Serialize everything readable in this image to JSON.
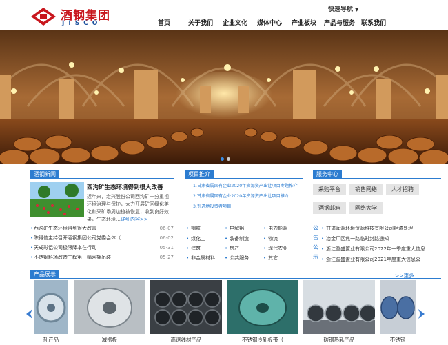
{
  "header": {
    "brand_cn": "酒钢集团",
    "brand_en": "JISCO",
    "quick_nav": "快速导航"
  },
  "nav": {
    "items": [
      "首页",
      "关于我们",
      "企业文化",
      "媒体中心",
      "产业板块",
      "产品与服务",
      "联系我们"
    ]
  },
  "banner": {
    "slides": 2,
    "active_slide": 1
  },
  "news": {
    "title": "酒钢新闻",
    "featured_title": "西沟矿生态环境得到很大改善",
    "featured_summary": "近年来，宏兴股份公司西沟矿十分重视环境治理与保护，大力开展矿区绿化美化和采矿场周边植被恢复，收到良好效果，生态环境…",
    "featured_more": "详细内容>>",
    "items": [
      {
        "title": "西沟矿生态环境得到很大改善",
        "date": "06-07"
      },
      {
        "title": "陈得信主持召开酒钢集团公司党委会体（",
        "date": "06-02"
      },
      {
        "title": "天成彩铝公司极限降本在行动",
        "date": "05-31"
      },
      {
        "title": "不锈钢料场改造工程第一幅网架吊装",
        "date": "05-27"
      }
    ]
  },
  "projects": {
    "title": "项目推介",
    "items": [
      "1.甘肃省属国有企业2020年资源资产出让项目专题推介",
      "2.甘肃省属国有企业2020年资源资产出让项目推介",
      "3.引进地投资者项目"
    ]
  },
  "industries": {
    "items": [
      "钢铁",
      "电解铝",
      "电力能源",
      "煤化工",
      "装备制造",
      "物流",
      "建筑",
      "房产",
      "现代农业",
      "非金属材料",
      "公共服务",
      "其它"
    ]
  },
  "services": {
    "title": "服务中心",
    "buttons": [
      "采购平台",
      "销售网络",
      "人才招聘",
      "酒钢邮箱",
      "网络大学"
    ],
    "notice_label": "公告公示",
    "notices": [
      "甘肃润源环境资源科技有限公司铝渣处理",
      "冶金厂区焦一路临时封路通知",
      "浙江盈盛置业有限公司2022年一季度重大信息",
      "浙江盈盛置业有限公司2021年度重大信息公"
    ]
  },
  "products": {
    "title": "产品展示",
    "more": ">>更多",
    "items": [
      "轧产品",
      "减振板",
      "高速线材产品",
      "不锈钢冷轧板带（",
      "碳钢热轧产品",
      "不锈钢"
    ]
  },
  "colors": {
    "brand_red": "#c8161d",
    "brand_blue": "#1b4f9c",
    "accent": "#2c7cd0"
  }
}
